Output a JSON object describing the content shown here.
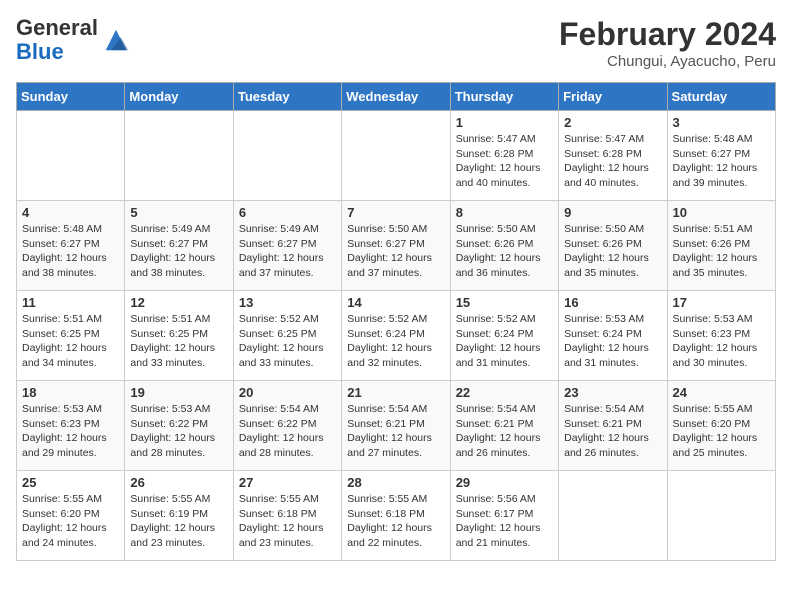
{
  "header": {
    "logo_general": "General",
    "logo_blue": "Blue",
    "month_year": "February 2024",
    "location": "Chungui, Ayacucho, Peru"
  },
  "days_of_week": [
    "Sunday",
    "Monday",
    "Tuesday",
    "Wednesday",
    "Thursday",
    "Friday",
    "Saturday"
  ],
  "weeks": [
    [
      {
        "day": "",
        "info": ""
      },
      {
        "day": "",
        "info": ""
      },
      {
        "day": "",
        "info": ""
      },
      {
        "day": "",
        "info": ""
      },
      {
        "day": "1",
        "info": "Sunrise: 5:47 AM\nSunset: 6:28 PM\nDaylight: 12 hours and 40 minutes."
      },
      {
        "day": "2",
        "info": "Sunrise: 5:47 AM\nSunset: 6:28 PM\nDaylight: 12 hours and 40 minutes."
      },
      {
        "day": "3",
        "info": "Sunrise: 5:48 AM\nSunset: 6:27 PM\nDaylight: 12 hours and 39 minutes."
      }
    ],
    [
      {
        "day": "4",
        "info": "Sunrise: 5:48 AM\nSunset: 6:27 PM\nDaylight: 12 hours and 38 minutes."
      },
      {
        "day": "5",
        "info": "Sunrise: 5:49 AM\nSunset: 6:27 PM\nDaylight: 12 hours and 38 minutes."
      },
      {
        "day": "6",
        "info": "Sunrise: 5:49 AM\nSunset: 6:27 PM\nDaylight: 12 hours and 37 minutes."
      },
      {
        "day": "7",
        "info": "Sunrise: 5:50 AM\nSunset: 6:27 PM\nDaylight: 12 hours and 37 minutes."
      },
      {
        "day": "8",
        "info": "Sunrise: 5:50 AM\nSunset: 6:26 PM\nDaylight: 12 hours and 36 minutes."
      },
      {
        "day": "9",
        "info": "Sunrise: 5:50 AM\nSunset: 6:26 PM\nDaylight: 12 hours and 35 minutes."
      },
      {
        "day": "10",
        "info": "Sunrise: 5:51 AM\nSunset: 6:26 PM\nDaylight: 12 hours and 35 minutes."
      }
    ],
    [
      {
        "day": "11",
        "info": "Sunrise: 5:51 AM\nSunset: 6:25 PM\nDaylight: 12 hours and 34 minutes."
      },
      {
        "day": "12",
        "info": "Sunrise: 5:51 AM\nSunset: 6:25 PM\nDaylight: 12 hours and 33 minutes."
      },
      {
        "day": "13",
        "info": "Sunrise: 5:52 AM\nSunset: 6:25 PM\nDaylight: 12 hours and 33 minutes."
      },
      {
        "day": "14",
        "info": "Sunrise: 5:52 AM\nSunset: 6:24 PM\nDaylight: 12 hours and 32 minutes."
      },
      {
        "day": "15",
        "info": "Sunrise: 5:52 AM\nSunset: 6:24 PM\nDaylight: 12 hours and 31 minutes."
      },
      {
        "day": "16",
        "info": "Sunrise: 5:53 AM\nSunset: 6:24 PM\nDaylight: 12 hours and 31 minutes."
      },
      {
        "day": "17",
        "info": "Sunrise: 5:53 AM\nSunset: 6:23 PM\nDaylight: 12 hours and 30 minutes."
      }
    ],
    [
      {
        "day": "18",
        "info": "Sunrise: 5:53 AM\nSunset: 6:23 PM\nDaylight: 12 hours and 29 minutes."
      },
      {
        "day": "19",
        "info": "Sunrise: 5:53 AM\nSunset: 6:22 PM\nDaylight: 12 hours and 28 minutes."
      },
      {
        "day": "20",
        "info": "Sunrise: 5:54 AM\nSunset: 6:22 PM\nDaylight: 12 hours and 28 minutes."
      },
      {
        "day": "21",
        "info": "Sunrise: 5:54 AM\nSunset: 6:21 PM\nDaylight: 12 hours and 27 minutes."
      },
      {
        "day": "22",
        "info": "Sunrise: 5:54 AM\nSunset: 6:21 PM\nDaylight: 12 hours and 26 minutes."
      },
      {
        "day": "23",
        "info": "Sunrise: 5:54 AM\nSunset: 6:21 PM\nDaylight: 12 hours and 26 minutes."
      },
      {
        "day": "24",
        "info": "Sunrise: 5:55 AM\nSunset: 6:20 PM\nDaylight: 12 hours and 25 minutes."
      }
    ],
    [
      {
        "day": "25",
        "info": "Sunrise: 5:55 AM\nSunset: 6:20 PM\nDaylight: 12 hours and 24 minutes."
      },
      {
        "day": "26",
        "info": "Sunrise: 5:55 AM\nSunset: 6:19 PM\nDaylight: 12 hours and 23 minutes."
      },
      {
        "day": "27",
        "info": "Sunrise: 5:55 AM\nSunset: 6:18 PM\nDaylight: 12 hours and 23 minutes."
      },
      {
        "day": "28",
        "info": "Sunrise: 5:55 AM\nSunset: 6:18 PM\nDaylight: 12 hours and 22 minutes."
      },
      {
        "day": "29",
        "info": "Sunrise: 5:56 AM\nSunset: 6:17 PM\nDaylight: 12 hours and 21 minutes."
      },
      {
        "day": "",
        "info": ""
      },
      {
        "day": "",
        "info": ""
      }
    ]
  ]
}
